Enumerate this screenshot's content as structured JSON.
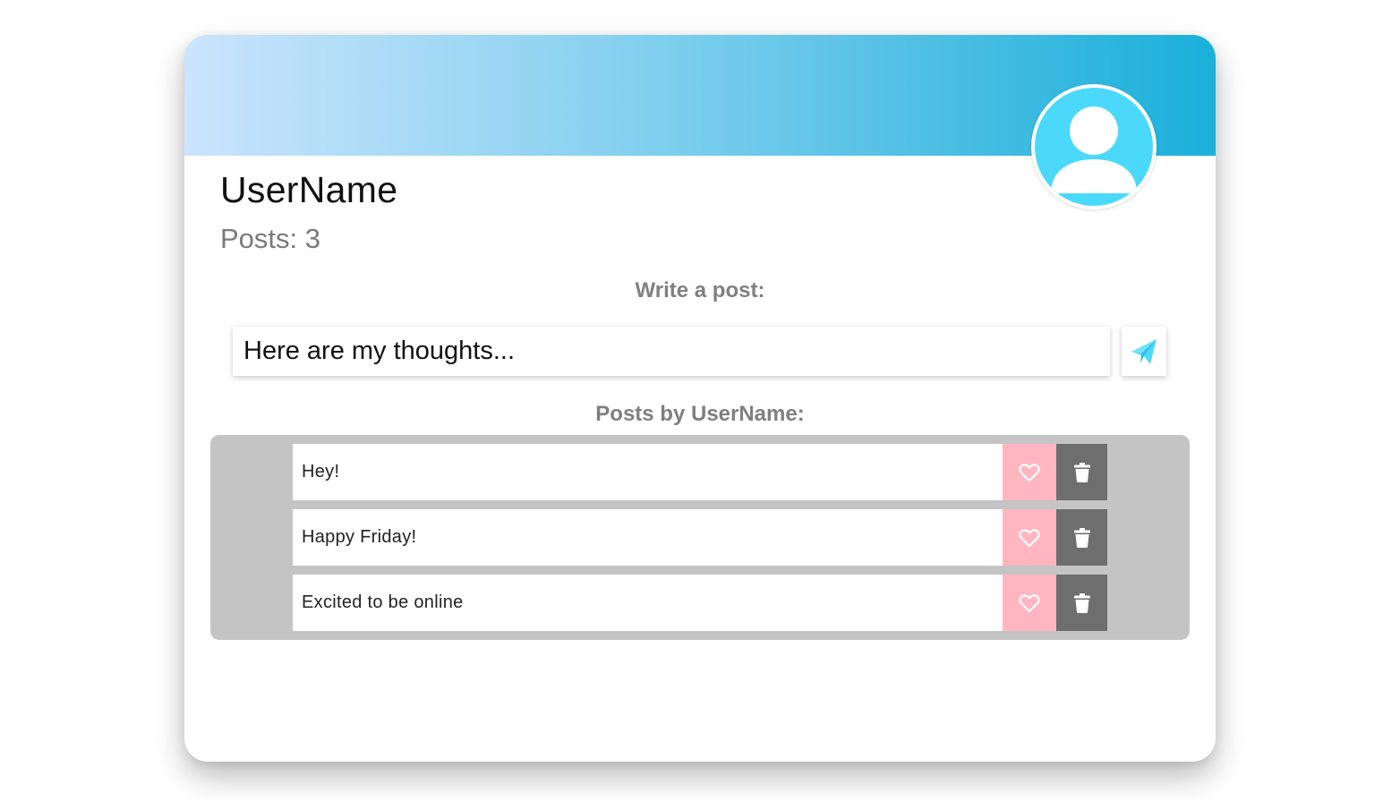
{
  "profile": {
    "username": "UserName",
    "posts_label": "Posts: 3"
  },
  "composer": {
    "title": "Write a post:",
    "placeholder": "Here are my thoughts...",
    "send_icon": "paper-plane-icon"
  },
  "feed": {
    "title": "Posts by UserName:",
    "posts": [
      {
        "text": "Hey!"
      },
      {
        "text": "Happy Friday!"
      },
      {
        "text": "Excited to be online"
      }
    ],
    "like_icon": "heart-outline-icon",
    "delete_icon": "trash-icon"
  },
  "colors": {
    "accent": "#4ad9fb",
    "like_bg": "#ffb6c1",
    "delete_bg": "#6e6e6e",
    "panel_bg": "#c4c4c4"
  }
}
